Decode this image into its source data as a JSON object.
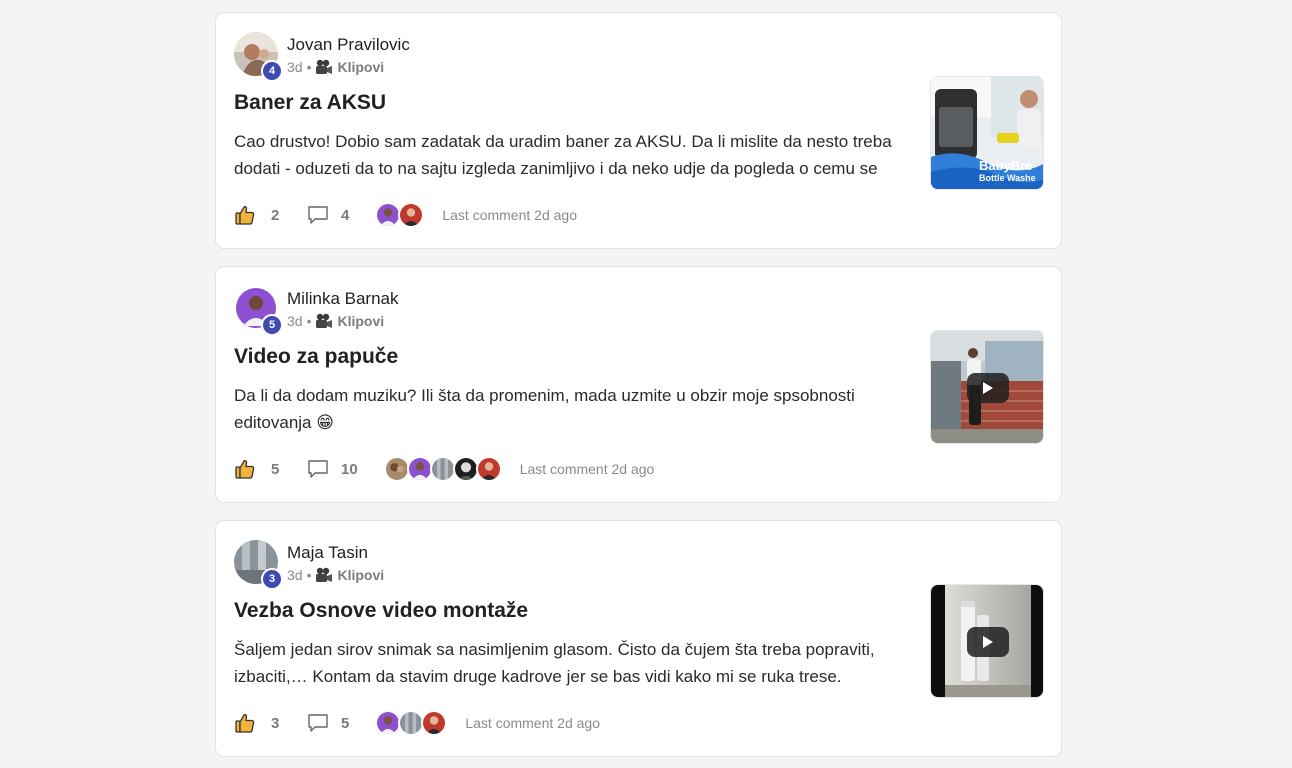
{
  "posts": [
    {
      "author": "Jovan Pravilovic",
      "level": "4",
      "time": "3d",
      "separator": "•",
      "category": "Klipovi",
      "title": "Baner za AKSU",
      "body": "Cao drustvo! Dobio sam zadatak da uradim baner za AKSU. Da li mislite da nesto treba dodati - oduzeti da to na sajtu izgleda zanimljivo i da neko udje da pogleda o cemu se",
      "likes": "2",
      "comments": "4",
      "last_comment": "Last comment 2d ago",
      "thumb_text": [
        "BabyBre",
        "Bottle Washe"
      ],
      "commenter_icons": [
        "avatar-purple",
        "avatar-red"
      ]
    },
    {
      "author": "Milinka Barnak",
      "level": "5",
      "time": "3d",
      "separator": "•",
      "category": "Klipovi",
      "title": "Video za papuče",
      "body": "Da li da dodam muziku? Ili šta da promenim, mada uzmite u obzir moje spsobnosti editovanja 😁",
      "likes": "5",
      "comments": "10",
      "last_comment": "Last comment 2d ago",
      "commenter_icons": [
        "avatar-brown",
        "avatar-purple",
        "avatar-grey",
        "avatar-dark",
        "avatar-red"
      ]
    },
    {
      "author": "Maja Tasin",
      "level": "3",
      "time": "3d",
      "separator": "•",
      "category": "Klipovi",
      "title": "Vezba Osnove video montaže",
      "body": "Šaljem jedan sirov snimak sa nasimljenim glasom. Čisto da čujem šta treba popraviti, izbaciti,… Kontam da stavim druge kadrove jer se bas vidi kako mi se ruka trese.",
      "likes": "3",
      "comments": "5",
      "last_comment": "Last comment 2d ago",
      "commenter_icons": [
        "avatar-purple",
        "avatar-grey",
        "avatar-red"
      ]
    }
  ],
  "colors": {
    "badge": "#3e4bb0",
    "like_icon": "#f2b33d",
    "muted_text": "#8a8a8a"
  }
}
